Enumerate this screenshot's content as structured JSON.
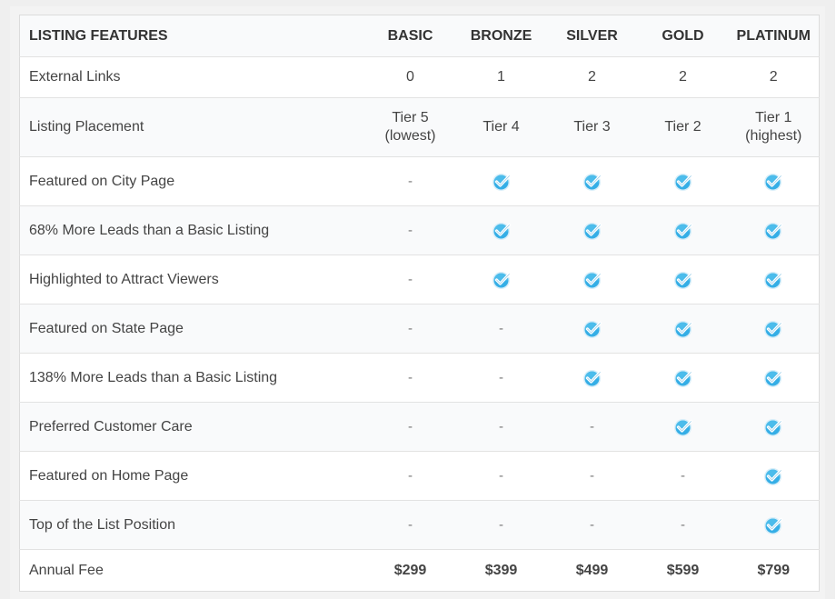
{
  "header": {
    "feature_label": "LISTING FEATURES",
    "tiers": [
      "BASIC",
      "BRONZE",
      "SILVER",
      "GOLD",
      "PLATINUM"
    ]
  },
  "rows": [
    {
      "feature": "External Links",
      "values": [
        "0",
        "1",
        "2",
        "2",
        "2"
      ]
    },
    {
      "feature": "Listing Placement",
      "values": [
        [
          "Tier 5",
          "(lowest)"
        ],
        [
          "Tier 4"
        ],
        [
          "Tier 3"
        ],
        [
          "Tier 2"
        ],
        [
          "Tier 1",
          "(highest)"
        ]
      ]
    },
    {
      "feature": "Featured on City Page",
      "values": [
        "-",
        "check",
        "check",
        "check",
        "check"
      ]
    },
    {
      "feature": "68% More Leads than a Basic Listing",
      "values": [
        "-",
        "check",
        "check",
        "check",
        "check"
      ]
    },
    {
      "feature": "Highlighted to Attract Viewers",
      "values": [
        "-",
        "check",
        "check",
        "check",
        "check"
      ]
    },
    {
      "feature": "Featured on State Page",
      "values": [
        "-",
        "-",
        "check",
        "check",
        "check"
      ]
    },
    {
      "feature": "138% More Leads than a Basic Listing",
      "values": [
        "-",
        "-",
        "check",
        "check",
        "check"
      ]
    },
    {
      "feature": "Preferred Customer Care",
      "values": [
        "-",
        "-",
        "-",
        "check",
        "check"
      ]
    },
    {
      "feature": "Featured on Home Page",
      "values": [
        "-",
        "-",
        "-",
        "-",
        "check"
      ]
    },
    {
      "feature": "Top of the List Position",
      "values": [
        "-",
        "-",
        "-",
        "-",
        "check"
      ]
    },
    {
      "feature": "Annual Fee",
      "values": [
        "$299",
        "$399",
        "$499",
        "$599",
        "$799"
      ]
    }
  ],
  "icons": {
    "included": "checkmark-badge-icon"
  },
  "colors": {
    "check_fill": "#35aee6",
    "check_dark": "#1c8fcc",
    "check_ring": "#d7eef9",
    "header_bg": "#f9fafb",
    "border": "#e2e2e2"
  }
}
